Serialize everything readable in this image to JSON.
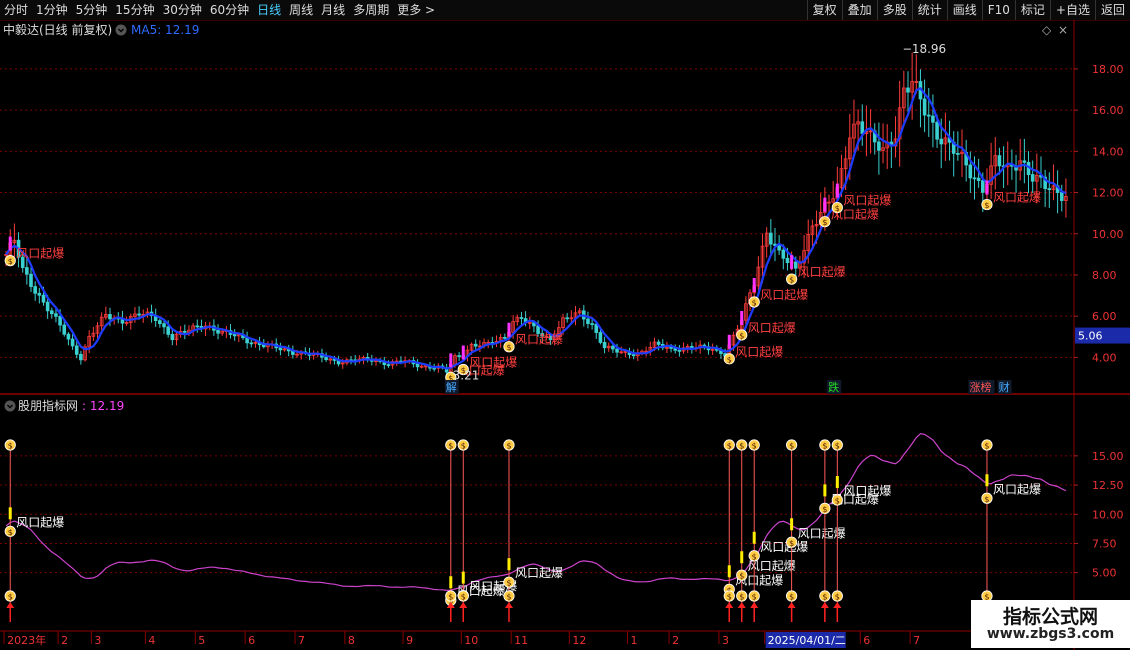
{
  "toolbar": {
    "periods": [
      "分时",
      "1分钟",
      "5分钟",
      "15分钟",
      "30分钟",
      "60分钟",
      "日线",
      "周线",
      "月线",
      "多周期",
      "更多 >"
    ],
    "active_period": "日线",
    "buttons": [
      "复权",
      "叠加",
      "多股",
      "统计",
      "画线",
      "F10",
      "标记",
      "+自选",
      "返回"
    ]
  },
  "header": {
    "stock": "中毅达(日线 前复权)",
    "ma_label": "MA5: 12.19",
    "sub_title": "股朋指标网",
    "sub_value": ": 12.19"
  },
  "colors": {
    "up": "#ff3b3b",
    "down": "#3ad0d0",
    "ma": "#1e3cff",
    "signal": "#ff4040",
    "magenta": "#ff33ff",
    "bag": "#ffcc44",
    "sub_line": "#cc44cc",
    "grid": "#7a0000",
    "price_tag_bg": "#1a2aa8"
  },
  "chart_data": {
    "type": "candlestick",
    "ylim_main": [
      3.0,
      19.5
    ],
    "ylim_sub": [
      1.8,
      18.5
    ],
    "main_ticks": [
      4.0,
      6.0,
      8.0,
      10.0,
      12.0,
      14.0,
      16.0,
      18.0
    ],
    "sub_ticks": [
      5.0,
      7.5,
      10.0,
      12.5,
      15.0
    ],
    "price_tag": "5.06",
    "max_label": "18.96",
    "min_label": "3.21",
    "signal_label": "风口起爆",
    "date_labels": [
      {
        "i": 0,
        "t": "2023年"
      },
      {
        "i": 13,
        "t": "2"
      },
      {
        "i": 21,
        "t": "3"
      },
      {
        "i": 34,
        "t": "4"
      },
      {
        "i": 46,
        "t": "5"
      },
      {
        "i": 58,
        "t": "6"
      },
      {
        "i": 70,
        "t": "7"
      },
      {
        "i": 82,
        "t": "8"
      },
      {
        "i": 96,
        "t": "9"
      },
      {
        "i": 110,
        "t": "10"
      },
      {
        "i": 122,
        "t": "11"
      },
      {
        "i": 136,
        "t": "12"
      },
      {
        "i": 150,
        "t": "1"
      },
      {
        "i": 160,
        "t": "2"
      },
      {
        "i": 172,
        "t": "3"
      },
      {
        "i": 183,
        "t": "2025/04/01/二"
      },
      {
        "i": 206,
        "t": "6"
      },
      {
        "i": 218,
        "t": "7"
      }
    ],
    "events": [
      {
        "i": 107,
        "t": "解"
      },
      {
        "i": 199,
        "t": "跌"
      },
      {
        "i": 233,
        "t": "涨榜"
      },
      {
        "i": 240,
        "t": "财"
      }
    ],
    "signals": [
      1,
      107,
      110,
      121,
      174,
      177,
      180,
      189,
      197,
      200,
      236
    ],
    "anchors": [
      [
        0,
        9.0
      ],
      [
        2,
        9.6
      ],
      [
        4,
        8.2
      ],
      [
        8,
        7.0
      ],
      [
        13,
        5.5
      ],
      [
        16,
        4.5
      ],
      [
        18,
        4.0
      ],
      [
        20,
        5.0
      ],
      [
        24,
        6.0
      ],
      [
        28,
        5.8
      ],
      [
        32,
        6.1
      ],
      [
        36,
        5.9
      ],
      [
        40,
        5.0
      ],
      [
        44,
        5.3
      ],
      [
        48,
        5.6
      ],
      [
        52,
        5.2
      ],
      [
        56,
        5.0
      ],
      [
        60,
        4.7
      ],
      [
        64,
        4.5
      ],
      [
        68,
        4.3
      ],
      [
        72,
        4.2
      ],
      [
        76,
        4.0
      ],
      [
        80,
        3.8
      ],
      [
        84,
        3.85
      ],
      [
        88,
        3.9
      ],
      [
        92,
        3.7
      ],
      [
        96,
        3.8
      ],
      [
        100,
        3.6
      ],
      [
        104,
        3.5
      ],
      [
        106,
        3.3
      ],
      [
        108,
        4.0
      ],
      [
        110,
        4.2
      ],
      [
        112,
        4.6
      ],
      [
        116,
        4.6
      ],
      [
        120,
        5.0
      ],
      [
        122,
        5.8
      ],
      [
        124,
        5.9
      ],
      [
        128,
        5.2
      ],
      [
        131,
        4.9
      ],
      [
        134,
        5.8
      ],
      [
        138,
        6.1
      ],
      [
        141,
        5.6
      ],
      [
        144,
        4.5
      ],
      [
        148,
        4.2
      ],
      [
        152,
        4.2
      ],
      [
        156,
        4.6
      ],
      [
        160,
        4.4
      ],
      [
        164,
        4.5
      ],
      [
        170,
        4.4
      ],
      [
        173,
        4.2
      ],
      [
        175,
        5.0
      ],
      [
        177,
        5.8
      ],
      [
        180,
        7.6
      ],
      [
        183,
        10.2
      ],
      [
        186,
        9.0
      ],
      [
        190,
        8.2
      ],
      [
        194,
        10.5
      ],
      [
        197,
        11.2
      ],
      [
        200,
        12.0
      ],
      [
        203,
        15.0
      ],
      [
        205,
        15.5
      ],
      [
        208,
        14.5
      ],
      [
        211,
        14.0
      ],
      [
        214,
        15.0
      ],
      [
        216,
        17.0
      ],
      [
        218,
        17.2
      ],
      [
        221,
        16.0
      ],
      [
        224,
        15.0
      ],
      [
        228,
        14.0
      ],
      [
        232,
        13.0
      ],
      [
        235,
        12.3
      ],
      [
        238,
        13.5
      ],
      [
        241,
        13.0
      ],
      [
        244,
        13.7
      ],
      [
        247,
        12.8
      ],
      [
        250,
        12.2
      ],
      [
        253,
        12.0
      ]
    ]
  }
}
